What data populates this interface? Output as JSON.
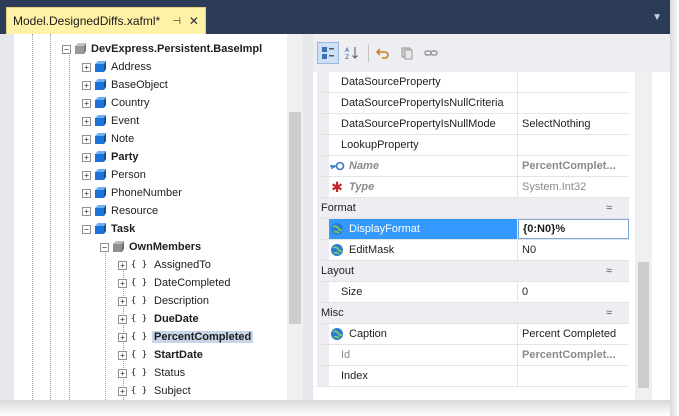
{
  "document_tab": {
    "title": "Model.DesignedDiffs.xafml*",
    "pin_glyph": "⊣",
    "close_glyph": "✕"
  },
  "tree": {
    "root": {
      "label": "DevExpress.Persistent.BaseImpl"
    },
    "classes": [
      {
        "label": "Address",
        "bold": false
      },
      {
        "label": "BaseObject",
        "bold": false
      },
      {
        "label": "Country",
        "bold": false
      },
      {
        "label": "Event",
        "bold": false
      },
      {
        "label": "Note",
        "bold": false
      },
      {
        "label": "Party",
        "bold": true
      },
      {
        "label": "Person",
        "bold": false
      },
      {
        "label": "PhoneNumber",
        "bold": false
      },
      {
        "label": "Resource",
        "bold": false
      },
      {
        "label": "Task",
        "bold": true
      }
    ],
    "own_members": {
      "label": "OwnMembers"
    },
    "members": [
      {
        "label": "AssignedTo",
        "bold": false,
        "selected": false
      },
      {
        "label": "DateCompleted",
        "bold": false,
        "selected": false
      },
      {
        "label": "Description",
        "bold": false,
        "selected": false
      },
      {
        "label": "DueDate",
        "bold": true,
        "selected": false
      },
      {
        "label": "PercentCompleted",
        "bold": true,
        "selected": true
      },
      {
        "label": "StartDate",
        "bold": true,
        "selected": false
      },
      {
        "label": "Status",
        "bold": false,
        "selected": false
      },
      {
        "label": "Subject",
        "bold": false,
        "selected": false
      }
    ]
  },
  "toolbar": {
    "buttons": [
      {
        "name": "categorized-icon",
        "active": true
      },
      {
        "name": "alphabetical-icon",
        "active": false
      },
      {
        "name": "undo-icon",
        "active": false
      },
      {
        "name": "copy-icon",
        "active": false
      },
      {
        "name": "link-icon",
        "active": false
      }
    ]
  },
  "properties": {
    "top_rows": [
      {
        "name": "DataSourceProperty",
        "value": ""
      },
      {
        "name": "DataSourcePropertyIsNullCriteria",
        "value": ""
      },
      {
        "name": "DataSourcePropertyIsNullMode",
        "value": "SelectNothing"
      },
      {
        "name": "LookupProperty",
        "value": ""
      },
      {
        "name": "Name",
        "value": "PercentComplet...",
        "icon": "key-icon",
        "readonly": true
      },
      {
        "name": "Type",
        "value": "System.Int32",
        "icon": "asterisk-icon",
        "readonly": true
      }
    ],
    "categories": {
      "format": {
        "label": "Format",
        "rows": [
          {
            "name": "DisplayFormat",
            "value": "{0:N0}%"
          },
          {
            "name": "EditMask",
            "value": "N0"
          }
        ]
      },
      "layout": {
        "label": "Layout",
        "rows": [
          {
            "name": "Size",
            "value": "0"
          }
        ]
      },
      "misc": {
        "label": "Misc",
        "rows": [
          {
            "name": "Caption",
            "value": "Percent Completed"
          },
          {
            "name": "Id",
            "value": "PercentComplet..."
          },
          {
            "name": "Index",
            "value": ""
          }
        ]
      }
    },
    "collapse_glyph": "≈"
  },
  "colors": {
    "title_bar": "#2b3b58",
    "document_tab": "#fff2a6",
    "selection_blue": "#3399ff",
    "tree_selection": "#c8d5e8",
    "cube_blue": "#1e73d8"
  }
}
